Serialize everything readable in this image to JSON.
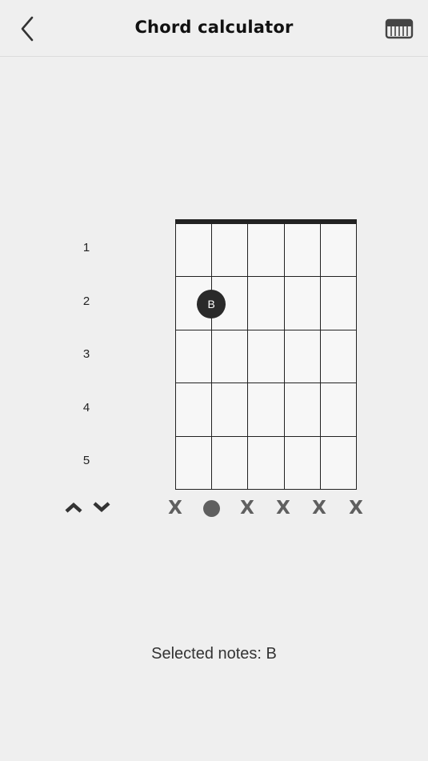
{
  "header": {
    "title": "Chord calculator",
    "back_icon": "chevron-left-icon",
    "piano_icon": "piano-keyboard-icon"
  },
  "fretboard": {
    "fret_numbers": [
      "1",
      "2",
      "3",
      "4",
      "5"
    ],
    "strings": 6,
    "frets": 5,
    "pressed": [
      {
        "string": 2,
        "fret": 2,
        "label": "B"
      }
    ]
  },
  "string_status": [
    {
      "string": 1,
      "state": "muted",
      "label": "X"
    },
    {
      "string": 2,
      "state": "played",
      "label": ""
    },
    {
      "string": 3,
      "state": "muted",
      "label": "X"
    },
    {
      "string": 4,
      "state": "muted",
      "label": "X"
    },
    {
      "string": 5,
      "state": "muted",
      "label": "X"
    },
    {
      "string": 6,
      "state": "muted",
      "label": "X"
    }
  ],
  "controls": {
    "up_icon": "chevron-up-icon",
    "down_icon": "chevron-down-icon"
  },
  "footer": {
    "selected_notes": "Selected notes: B"
  },
  "colors": {
    "background": "#efefef",
    "fret_line": "#222222",
    "marker": "#2a2a2a",
    "status_gray": "#5f5f5f"
  }
}
